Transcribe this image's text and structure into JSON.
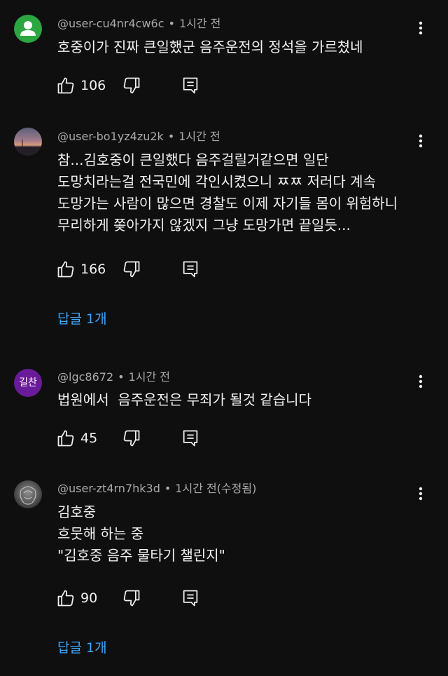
{
  "comments": [
    {
      "author": "@user-cu4nr4cw6c",
      "time": "1시간 전",
      "lines": [
        "호중이가 진짜 큰일했군 음주운전의 정석을 가르쳤네"
      ],
      "likes": "106",
      "avatar": "default-person-green"
    },
    {
      "author": "@user-bo1yz4zu2k",
      "time": "1시간 전",
      "lines": [
        "참...김호중이 큰일했다 음주걸릴거같으면 일단",
        "도망치라는걸 전국민에 각인시켰으니 ㅉㅉ 저러다 계속",
        "도망가는 사람이 많으면 경찰도 이제 자기들 몸이 위험하니",
        "무리하게 쫒아가지 않겠지 그냥 도망가면 끝일듯..."
      ],
      "likes": "166",
      "replies": "답글 1개",
      "avatar": "sunset-photo"
    },
    {
      "author": "@lgc8672",
      "time": "1시간 전",
      "lines": [
        "법원에서  음주운전은 무죄가 될것 같습니다"
      ],
      "likes": "45",
      "avatar_text": "길찬",
      "avatar_color": "#6a1b9a"
    },
    {
      "author": "@user-zt4rn7hk3d",
      "time": "1시간 전(수정됨)",
      "lines": [
        "김호중",
        "흐뭇해 하는 중",
        "\"김호중 음주 물타기 챌린지\""
      ],
      "likes": "90",
      "replies": "답글 1개",
      "avatar": "stone-statue-photo"
    }
  ],
  "colors": {
    "background": "#0f0f0f",
    "text": "#f1f1f1",
    "meta": "#aaaaaa",
    "link": "#3ea6ff"
  }
}
